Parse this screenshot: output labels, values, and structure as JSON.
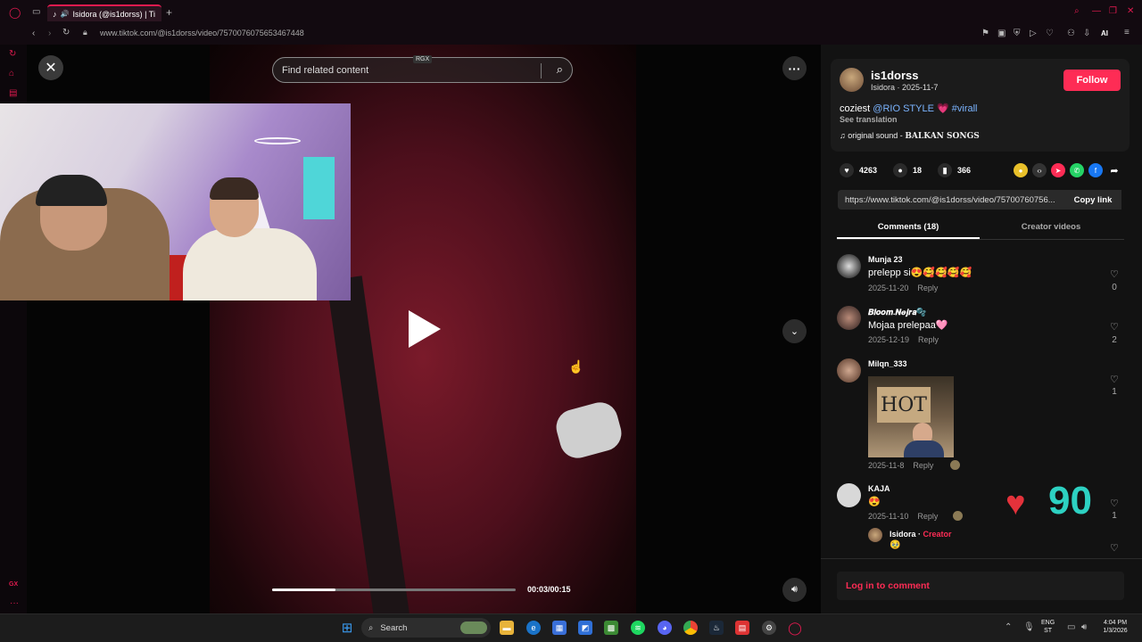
{
  "browser": {
    "tab_title": "Isidora (@is1dorss) | Ti",
    "url": "www.tiktok.com/@is1dorss/video/7570076075653467448",
    "ai_label": "AI"
  },
  "video": {
    "search_placeholder": "Find related content",
    "rgx_badge": "RGX",
    "time": "00:03/00:15",
    "progress": 0.26
  },
  "author": {
    "username": "is1dorss",
    "subline": "Isidora · 2025-11-7",
    "follow_label": "Follow",
    "caption_prefix": "coziest ",
    "caption_mention": "@RIO STYLE",
    "caption_emoji": "💗",
    "caption_hashtag": "#virall",
    "see_translation": "See translation",
    "sound_prefix": "original sound - ",
    "sound_name": "BALKAN SONGS"
  },
  "stats": {
    "likes": "4263",
    "comments": "18",
    "saves": "366"
  },
  "share": {
    "link": "https://www.tiktok.com/@is1dorss/video/75700760756...",
    "copy_label": "Copy link"
  },
  "tabs": {
    "comments": "Comments (18)",
    "creator_videos": "Creator videos"
  },
  "comments": [
    {
      "name": "Munja 23",
      "text": "prelepp si😍🥰🥰🥰🥰",
      "date": "2025-11-20",
      "reply": "Reply",
      "likes": "0"
    },
    {
      "name": "𝑩𝒍𝒐𝒐𝒎.𝑵𝒆𝒋𝒓𝒂🫧",
      "text": "Mojaa prelepaa🩷",
      "date": "2025-12-19",
      "reply": "Reply",
      "likes": "2"
    },
    {
      "name": "Milqn_333",
      "text": "HOT",
      "date": "2025-11-8",
      "reply": "Reply",
      "likes": "1"
    },
    {
      "name": "KAJA",
      "text": "😍",
      "date": "2025-11-10",
      "reply": "Reply",
      "likes": "1"
    }
  ],
  "creator_reply": {
    "name": "Isidora",
    "sep": " · ",
    "tag": "Creator",
    "text": "🥹"
  },
  "overlay": {
    "heart_count": "90"
  },
  "login_label": "Log in to comment",
  "taskbar": {
    "search_label": "Search",
    "lang_top": "ENG",
    "lang_bottom": "ST",
    "clock_time": "4:04 PM",
    "clock_date": "1/3/2026"
  },
  "sidebar": {
    "gx_label": "GX"
  },
  "colors": {
    "accent": "#fe2c55",
    "link": "#7bb4ff",
    "opera_red": "#e01a4f"
  }
}
